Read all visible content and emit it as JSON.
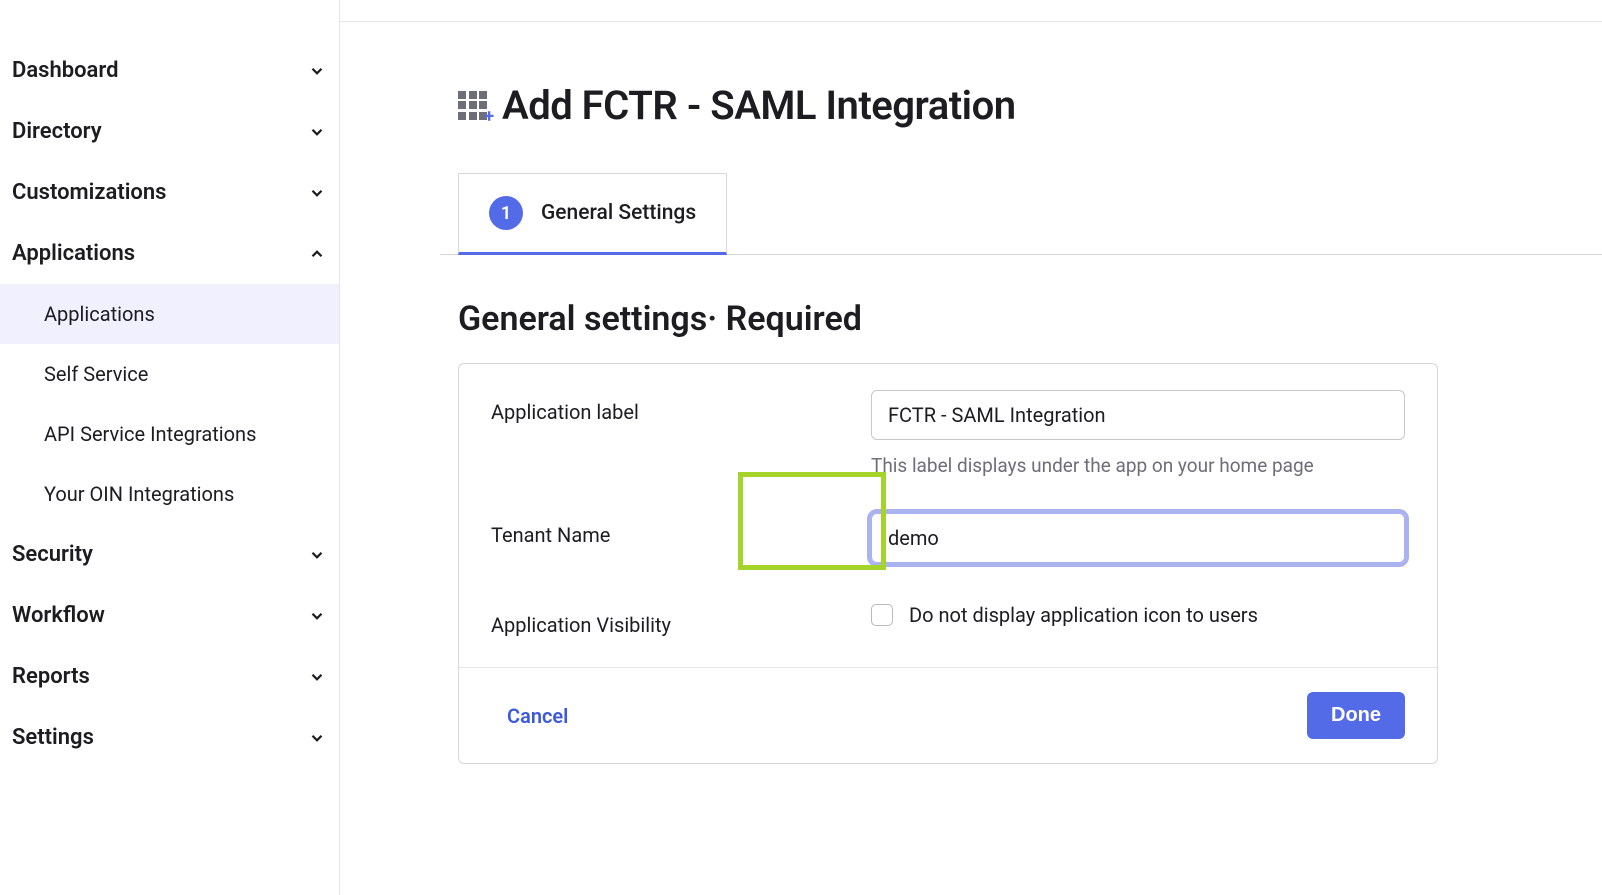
{
  "sidebar": {
    "items": [
      {
        "label": "Dashboard",
        "expanded": false
      },
      {
        "label": "Directory",
        "expanded": false
      },
      {
        "label": "Customizations",
        "expanded": false
      },
      {
        "label": "Applications",
        "expanded": true,
        "children": [
          {
            "label": "Applications",
            "active": true
          },
          {
            "label": "Self Service"
          },
          {
            "label": "API Service Integrations"
          },
          {
            "label": "Your OIN Integrations"
          }
        ]
      },
      {
        "label": "Security",
        "expanded": false
      },
      {
        "label": "Workflow",
        "expanded": false
      },
      {
        "label": "Reports",
        "expanded": false
      },
      {
        "label": "Settings",
        "expanded": false
      }
    ]
  },
  "page": {
    "title": "Add FCTR - SAML Integration"
  },
  "tab": {
    "step_number": "1",
    "label": "General Settings"
  },
  "section": {
    "heading": "General settings· Required"
  },
  "form": {
    "app_label": {
      "label": "Application label",
      "value": "FCTR - SAML Integration",
      "help": "This label displays under the app on your home page"
    },
    "tenant_name": {
      "label": "Tenant Name",
      "value": "demo"
    },
    "visibility": {
      "label": "Application Visibility",
      "checkbox_label": "Do not display application icon to users"
    }
  },
  "footer": {
    "cancel": "Cancel",
    "done": "Done"
  }
}
